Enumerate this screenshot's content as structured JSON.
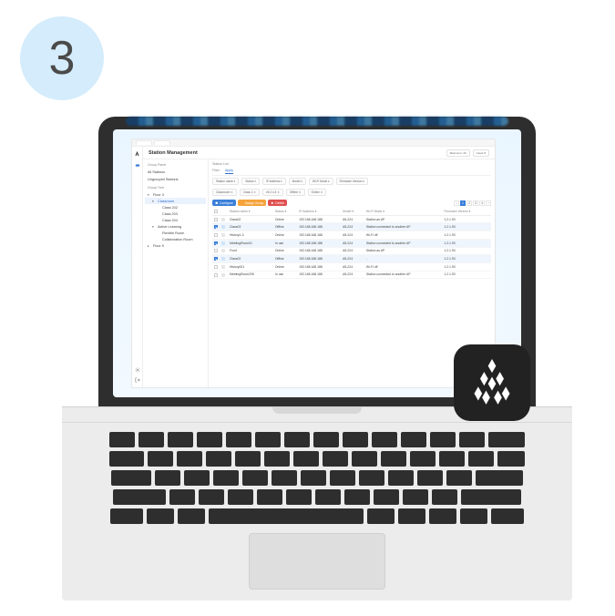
{
  "step": "3",
  "tabs": [
    "",
    ""
  ],
  "page": {
    "title": "Station Management",
    "group_panel_title": "Group Panel",
    "station_list_title": "Station List",
    "header_actions": [
      "Maximum: 40",
      "Used: 8"
    ]
  },
  "tree": {
    "all_label": "All Stations",
    "ungrouped_label": "Ungrouped Stations",
    "tree_header": "Group Tree",
    "nodes": [
      {
        "label": "Floor 3",
        "level": 1,
        "expanded": true
      },
      {
        "label": "Classroom",
        "level": 2,
        "selected": true,
        "expanded": true
      },
      {
        "label": "Class 202",
        "level": 3
      },
      {
        "label": "Class 203",
        "level": 3
      },
      {
        "label": "Class 204",
        "level": 3
      },
      {
        "label": "Active Learning",
        "level": 2,
        "expanded": true
      },
      {
        "label": "Flexible Room",
        "level": 3
      },
      {
        "label": "Collaboration Room",
        "level": 3
      },
      {
        "label": "Floor 5",
        "level": 1
      }
    ]
  },
  "filters": {
    "tab_filter": "Filter",
    "tab_apply": "Apply",
    "pills_row1": [
      "Station name ▾",
      "Status ▾",
      "IP Address ▾",
      "Model ▾",
      "Wi-Fi Mode ▾",
      "Firmware Version ▾"
    ],
    "pills_row2": [
      "Classroom ✕",
      "Class 1 ✕",
      "v5.2.4.4 ✕",
      "Offline ✕",
      "Online ✕"
    ]
  },
  "actions": {
    "configure": "Configure",
    "assign_group": "Assign Group",
    "delete": "Delete"
  },
  "pagination": {
    "pages": [
      "‹",
      "1",
      "2",
      "3",
      "4",
      "›"
    ],
    "active": "1"
  },
  "table": {
    "columns": [
      "Station name ▾",
      "Status ▾",
      "IP Address ▾",
      "Model ▾",
      "Wi-Fi Mode ▾",
      "Firmware Version ▾"
    ],
    "rows": [
      {
        "checked": false,
        "icon": "gray",
        "name": "Class02",
        "status": "Online",
        "status_class": "online",
        "ip": "192.168.168.188",
        "model": "A5-224",
        "wifi": "Station as AP",
        "fw": "1.2.1.93"
      },
      {
        "checked": true,
        "icon": "blue",
        "name": "Class03",
        "status": "Offline",
        "status_class": "offline",
        "ip": "192.168.168.188",
        "model": "A5-224",
        "wifi": "Station connected to another AP",
        "fw": "1.2.1.93"
      },
      {
        "checked": false,
        "icon": "gray",
        "name": "History1-3",
        "status": "Online",
        "status_class": "online",
        "ip": "192.168.168.188",
        "model": "A5-224",
        "wifi": "Wi-Fi off",
        "fw": "1.2.1.93"
      },
      {
        "checked": true,
        "icon": "blue",
        "name": "MeetingRoom01",
        "status": "In use",
        "status_class": "inuse",
        "ip": "192.168.168.188",
        "model": "A5-224",
        "wifi": "Station connected to another AP",
        "fw": "1.2.1.93"
      },
      {
        "checked": false,
        "icon": "gray",
        "name": "Front",
        "status": "Online",
        "status_class": "online",
        "ip": "192.168.168.188",
        "model": "A5-224",
        "wifi": "Station as AP",
        "fw": "1.2.1.93"
      },
      {
        "checked": true,
        "icon": "blue",
        "name": "Class02",
        "status": "Offline",
        "status_class": "offline",
        "ip": "192.168.168.188",
        "model": "A5-224",
        "wifi": "-",
        "fw": "1.2.1.93"
      },
      {
        "checked": false,
        "icon": "gray",
        "name": "History001",
        "status": "Online",
        "status_class": "online",
        "ip": "192.168.168.188",
        "model": "A5-224",
        "wifi": "Wi-Fi off",
        "fw": "1.2.1.93"
      },
      {
        "checked": false,
        "icon": "gray",
        "name": "MeetingRoom205",
        "status": "In use",
        "status_class": "inuse",
        "ip": "192.168.168.188",
        "model": "A5-224",
        "wifi": "Station connected to another AP",
        "fw": "1.2.1.93"
      }
    ]
  }
}
